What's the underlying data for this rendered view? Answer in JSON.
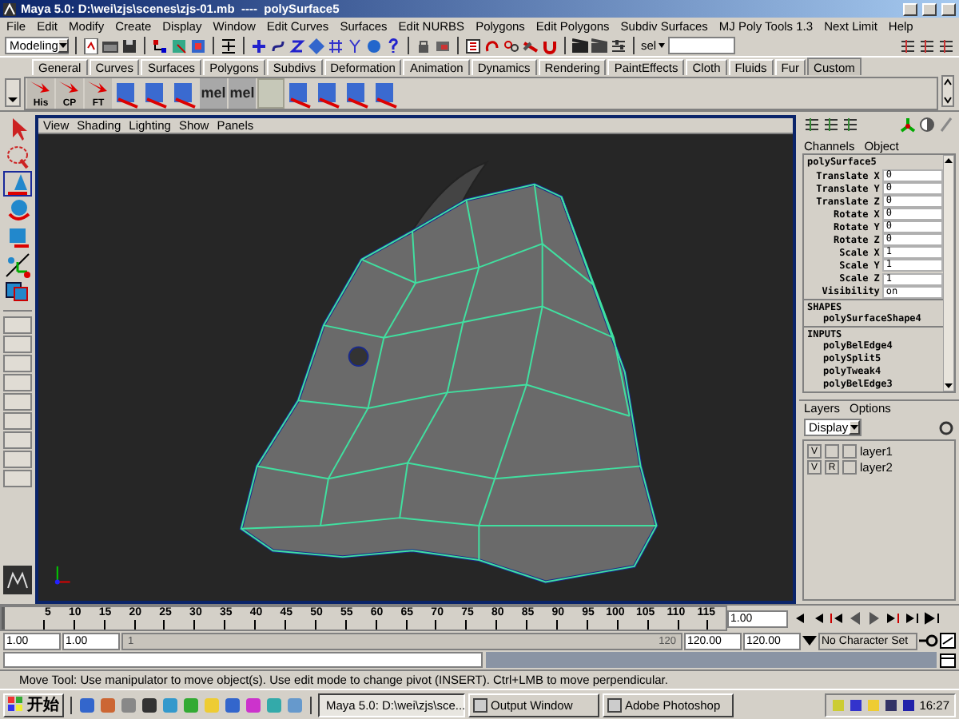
{
  "window": {
    "title": "Maya 5.0: D:\\wei\\zjs\\scenes\\zjs-01.mb  ----  polySurface5"
  },
  "menu": [
    "File",
    "Edit",
    "Modify",
    "Create",
    "Display",
    "Window",
    "Edit Curves",
    "Surfaces",
    "Edit NURBS",
    "Polygons",
    "Edit Polygons",
    "Subdiv Surfaces",
    "MJ Poly Tools 1.3",
    "Next Limit",
    "Help"
  ],
  "toolbar": {
    "mode": "Modeling",
    "selection_mode": "sel"
  },
  "shelf": {
    "tabs": [
      {
        "label": "General",
        "selected": false
      },
      {
        "label": "Curves",
        "selected": false
      },
      {
        "label": "Surfaces",
        "selected": false
      },
      {
        "label": "Polygons",
        "selected": false
      },
      {
        "label": "Subdivs",
        "selected": false
      },
      {
        "label": "Deformation",
        "selected": false
      },
      {
        "label": "Animation",
        "selected": false
      },
      {
        "label": "Dynamics",
        "selected": false
      },
      {
        "label": "Rendering",
        "selected": false
      },
      {
        "label": "PaintEffects",
        "selected": false
      },
      {
        "label": "Cloth",
        "selected": false
      },
      {
        "label": "Fluids",
        "selected": false
      },
      {
        "label": "Fur",
        "selected": false
      },
      {
        "label": "Custom",
        "selected": true
      }
    ],
    "items": [
      {
        "kind": "labeled",
        "label": "His"
      },
      {
        "kind": "labeled",
        "label": "CP"
      },
      {
        "kind": "labeled",
        "label": "FT"
      },
      {
        "kind": "icon"
      },
      {
        "kind": "icon"
      },
      {
        "kind": "icon"
      },
      {
        "kind": "mel",
        "label": "mel"
      },
      {
        "kind": "mel",
        "label": "mel"
      },
      {
        "kind": "blank"
      },
      {
        "kind": "icon"
      },
      {
        "kind": "icon"
      },
      {
        "kind": "icon"
      },
      {
        "kind": "icon"
      }
    ]
  },
  "tools": [
    {
      "kind": "select",
      "selected": false
    },
    {
      "kind": "lasso",
      "selected": false
    },
    {
      "kind": "move",
      "selected": true
    },
    {
      "kind": "rotate",
      "selected": false
    },
    {
      "kind": "scale",
      "selected": false
    },
    {
      "kind": "manipulator",
      "selected": false
    },
    {
      "kind": "last",
      "selected": false
    }
  ],
  "viewport": {
    "menu": [
      "View",
      "Shading",
      "Lighting",
      "Show",
      "Panels"
    ]
  },
  "channel_box": {
    "menu": [
      "Channels",
      "Object"
    ],
    "node": "polySurface5",
    "attributes": [
      {
        "name": "Translate X",
        "value": "0"
      },
      {
        "name": "Translate Y",
        "value": "0"
      },
      {
        "name": "Translate Z",
        "value": "0"
      },
      {
        "name": "Rotate X",
        "value": "0"
      },
      {
        "name": "Rotate Y",
        "value": "0"
      },
      {
        "name": "Rotate Z",
        "value": "0"
      },
      {
        "name": "Scale X",
        "value": "1"
      },
      {
        "name": "Scale Y",
        "value": "1"
      },
      {
        "name": "Scale Z",
        "value": "1"
      },
      {
        "name": "Visibility",
        "value": "on"
      }
    ],
    "shapes_header": "SHAPES",
    "shapes": [
      "polySurfaceShape4"
    ],
    "inputs_header": "INPUTS",
    "inputs": [
      "polyBelEdge4",
      "polySplit5",
      "polyTweak4",
      "polyBelEdge3"
    ]
  },
  "layers": {
    "menu": [
      "Layers",
      "Options"
    ],
    "display": "Display",
    "items": [
      {
        "visible": "V",
        "name": "layer1"
      },
      {
        "visible": "V",
        "reference": "R",
        "name": "layer2"
      }
    ]
  },
  "timeline": {
    "ticks": [
      "5",
      "10",
      "15",
      "20",
      "25",
      "30",
      "35",
      "40",
      "45",
      "50",
      "55",
      "60",
      "65",
      "70",
      "75",
      "80",
      "85",
      "90",
      "95",
      "100",
      "105",
      "110",
      "115"
    ],
    "current_frame": "1.00",
    "level": 0
  },
  "range": {
    "level": 1,
    "start": "1.00",
    "range_start": "1.00",
    "slider_start": "1",
    "slider_end": "120",
    "range_end": "120.00",
    "end": "120.00",
    "character_set": "No Character Set"
  },
  "help_line": "Move Tool: Use manipulator to move object(s). Use edit mode to change pivot (INSERT).  Ctrl+LMB to move perpendicular.",
  "taskbar": {
    "start": "开始",
    "tasks": [
      {
        "label": "Maya 5.0: D:\\wei\\zjs\\sce...",
        "selected": true
      },
      {
        "label": "Output Window",
        "selected": false
      },
      {
        "label": "Adobe Photoshop",
        "selected": false
      }
    ],
    "clock": "16:27"
  }
}
